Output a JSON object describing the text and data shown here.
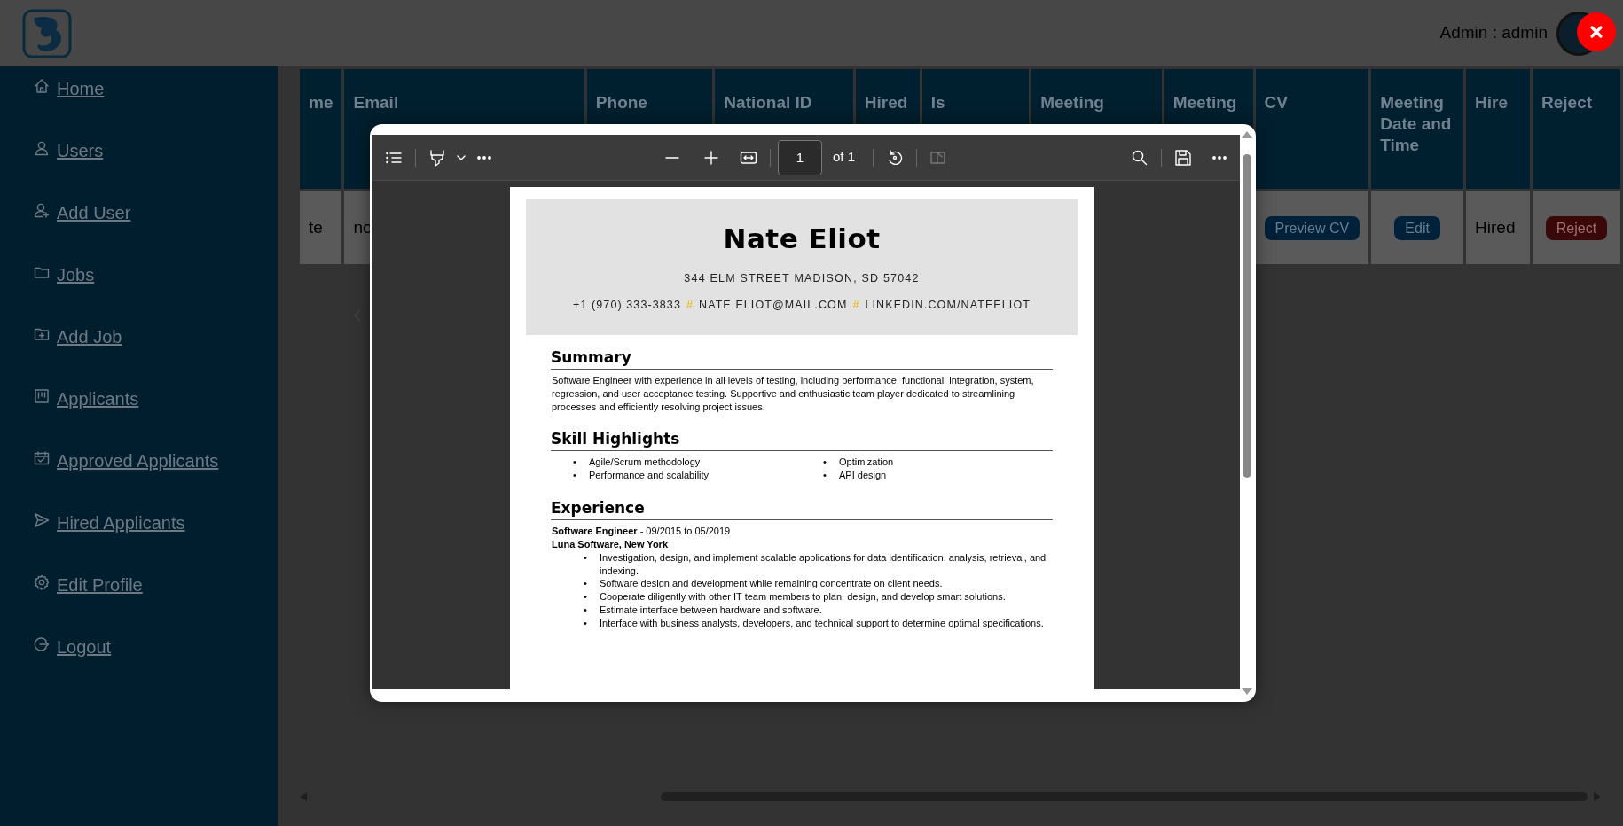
{
  "header": {
    "user_label": "Admin : admin"
  },
  "sidebar": {
    "items": [
      {
        "label": "Home"
      },
      {
        "label": "Users"
      },
      {
        "label": "Add User"
      },
      {
        "label": "Jobs"
      },
      {
        "label": "Add Job"
      },
      {
        "label": "Applicants"
      },
      {
        "label": "Approved Applicants"
      },
      {
        "label": "Hired Applicants"
      },
      {
        "label": "Edit Profile"
      },
      {
        "label": "Logout"
      }
    ]
  },
  "table": {
    "columns": [
      "me",
      "Email",
      "Phone",
      "National ID",
      "Hired",
      "Is",
      "Meeting",
      "Meeting",
      "CV",
      "Meeting Date and Time",
      "Hire",
      "Reject"
    ],
    "rows": [
      {
        "cells": [
          {
            "kind": "text",
            "text": "te"
          },
          {
            "kind": "text",
            "text": "no"
          },
          {},
          {},
          {},
          {},
          {},
          {},
          {
            "kind": "primary-button",
            "text": "Preview CV"
          },
          {
            "kind": "primary-button",
            "text": "Edit"
          },
          {
            "kind": "text",
            "text": "Hired"
          },
          {
            "kind": "danger-button",
            "text": "Reject"
          }
        ]
      }
    ]
  },
  "pdf_viewer": {
    "toolbar": {
      "page_number": "1",
      "page_count": "of 1",
      "spread_button": {
        "disabled": true
      }
    },
    "document": {
      "name": "Nate Eliot",
      "address": "344 ELM STREET MADISON, SD 57042",
      "contact": [
        {
          "kind": "value",
          "text": "+1 (970) 333-3833"
        },
        {
          "kind": "separator",
          "text": "#"
        },
        {
          "kind": "value",
          "text": "NATE.ELIOT@MAIL.COM"
        },
        {
          "kind": "separator",
          "text": "#"
        },
        {
          "kind": "value",
          "text": "LINKEDIN.COM/NATEELIOT"
        }
      ],
      "sections": [
        {
          "kind": "paragraph",
          "heading": "Summary",
          "text": "Software Engineer with experience in all levels of testing, including performance, functional, integration, system, regression, and user acceptance testing. Supportive and enthusiastic team player dedicated to streamlining processes and efficiently resolving project issues."
        },
        {
          "kind": "columns",
          "heading": "Skill Highlights",
          "columns": [
            [
              {
                "marker": "•",
                "text": "Agile/Scrum methodology"
              },
              {
                "marker": "•",
                "text": "Performance and scalability"
              }
            ],
            [
              {
                "marker": "•",
                "text": "Optimization"
              },
              {
                "marker": "•",
                "text": "API design"
              }
            ]
          ]
        },
        {
          "kind": "jobs",
          "heading": "Experience",
          "jobs": [
            {
              "title": "**Software Engineer** - 09/2015 to 05/2019",
              "company": "Luna Software, New York",
              "bullets": [
                {
                  "marker": "•",
                  "text": "Investigation, design, and implement scalable applications for data identification, analysis, retrieval, and indexing."
                },
                {
                  "marker": "•",
                  "text": "Software design and development while remaining concentrate on client needs."
                },
                {
                  "marker": "•",
                  "text": "Cooperate diligently with other IT team members to plan, design, and develop smart solutions."
                },
                {
                  "marker": "•",
                  "text": "Estimate interface between hardware and software."
                },
                {
                  "marker": "•",
                  "text": "Interface with business analysts, developers, and technical support to determine optimal specifications."
                }
              ]
            }
          ]
        }
      ]
    }
  }
}
